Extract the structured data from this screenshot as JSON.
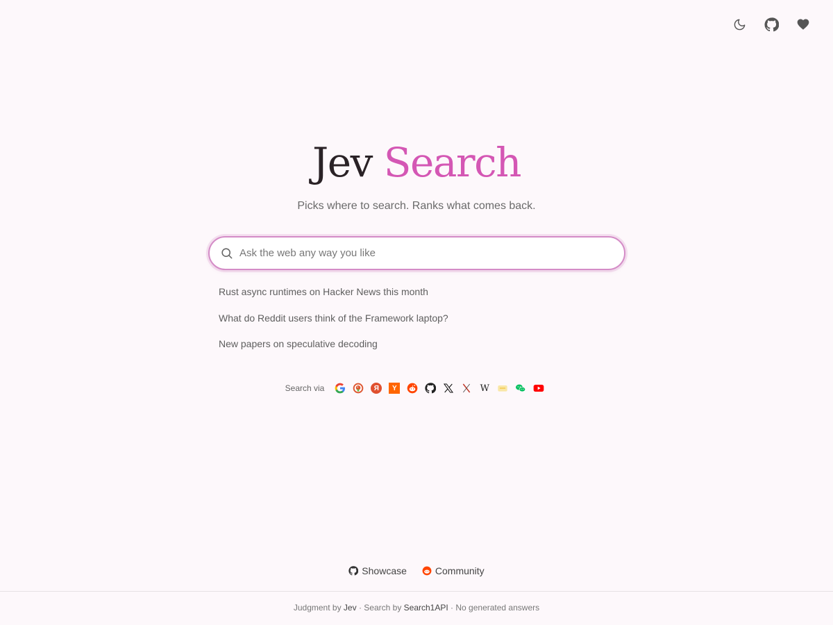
{
  "header": {
    "icons": [
      "moon-icon",
      "github-icon",
      "heart-icon"
    ]
  },
  "brand": {
    "word1": "Jev",
    "word2": "Search",
    "accent_color": "#d457b4"
  },
  "tagline": "Picks where to search. Ranks what comes back.",
  "search": {
    "placeholder": "Ask the web any way you like",
    "value": ""
  },
  "suggestions": [
    "Rust async runtimes on Hacker News this month",
    "What do Reddit users think of the Framework laptop?",
    "New papers on speculative decoding"
  ],
  "sources": {
    "label": "Search via",
    "items": [
      "google-icon",
      "duckduckgo-icon",
      "yandex-icon",
      "hacker-news-icon",
      "reddit-icon",
      "github-icon",
      "x-icon",
      "xiaohongshu-icon",
      "wikipedia-icon",
      "bilibili-icon",
      "wechat-icon",
      "youtube-icon"
    ]
  },
  "footer_links": {
    "showcase": "Showcase",
    "community": "Community"
  },
  "credits": {
    "prefix": "Judgment by",
    "judge": "Jev",
    "middle": "· Search by",
    "search_provider": "Search1API",
    "suffix": "· No generated answers"
  }
}
